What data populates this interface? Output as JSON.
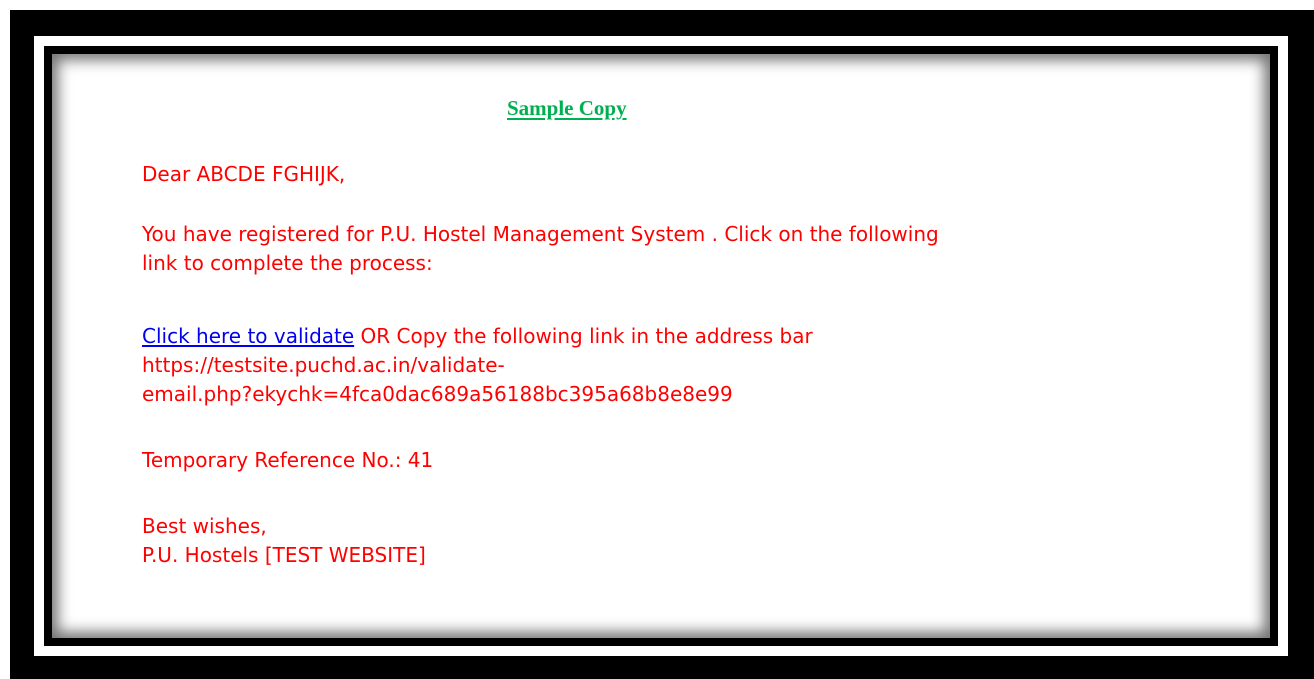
{
  "title": "Sample Copy",
  "salutation": "Dear ABCDE FGHIJK,",
  "registration": {
    "line1": "You have registered for P.U. Hostel Management System . Click on the following",
    "line2": "link to complete the process:"
  },
  "validation": {
    "link_text": "Click here to validate",
    "after_link": " OR Copy the following link in the address bar",
    "url_line1": "https://testsite.puchd.ac.in/validate-",
    "url_line2": "email.php?ekychk=4fca0dac689a56188bc395a68b8e8e99"
  },
  "reference": "Temporary Reference No.: 41",
  "closing": {
    "line1": "Best wishes,",
    "line2": "P.U. Hostels [TEST WEBSITE]"
  },
  "colors": {
    "body_text": "#ff0000",
    "title": "#00b050",
    "link": "#0000ee",
    "frame": "#000000"
  }
}
